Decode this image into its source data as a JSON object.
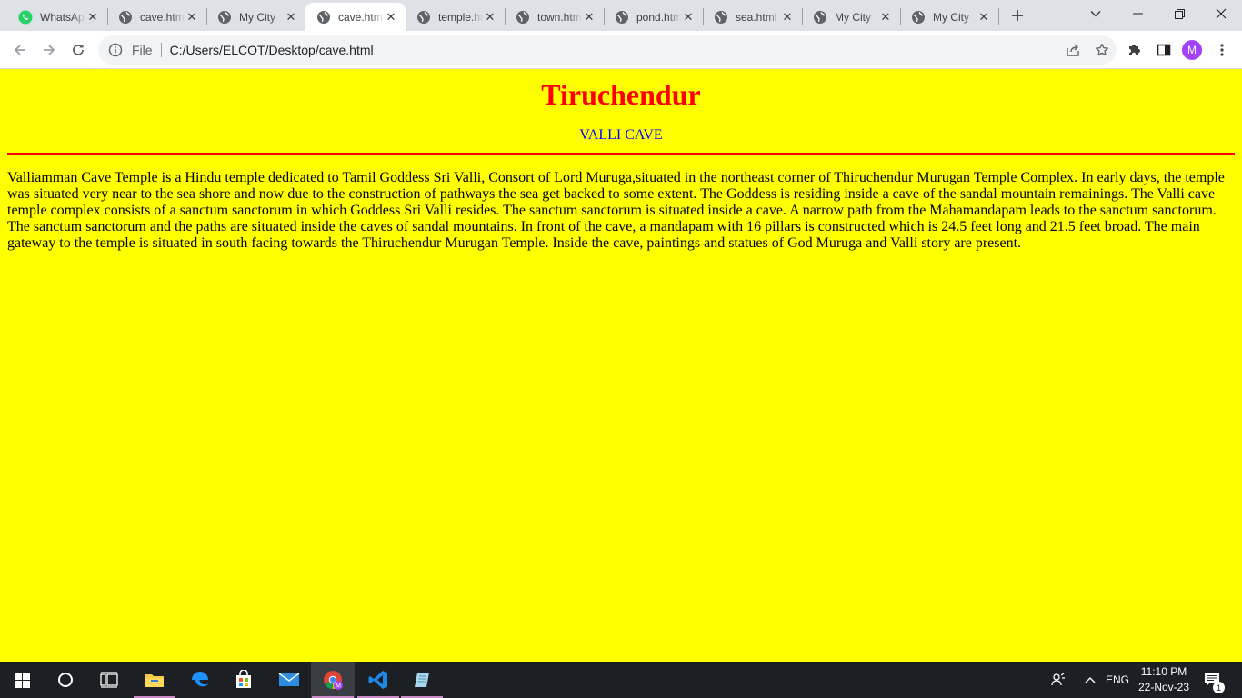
{
  "browser": {
    "tabs": [
      {
        "title": "WhatsApp",
        "icon": "whatsapp-icon",
        "active": false
      },
      {
        "title": "cave.html",
        "icon": "globe-icon",
        "active": false
      },
      {
        "title": "My City",
        "icon": "globe-icon",
        "active": false
      },
      {
        "title": "cave.html",
        "icon": "globe-icon",
        "active": true
      },
      {
        "title": "temple.html",
        "icon": "globe-icon",
        "active": false
      },
      {
        "title": "town.html",
        "icon": "globe-icon",
        "active": false
      },
      {
        "title": "pond.html",
        "icon": "globe-icon",
        "active": false
      },
      {
        "title": "sea.html",
        "icon": "globe-icon",
        "active": false
      },
      {
        "title": "My City",
        "icon": "globe-icon",
        "active": false
      },
      {
        "title": "My City",
        "icon": "globe-icon",
        "active": false
      }
    ],
    "address": {
      "scheme_label": "File",
      "url": "C:/Users/ELCOT/Desktop/cave.html"
    },
    "profile_initial": "M"
  },
  "page": {
    "title": "Tiruchendur",
    "subtitle": "VALLI CAVE",
    "paragraph": "Valliamman Cave Temple is a Hindu temple dedicated to Tamil Goddess Sri Valli, Consort of Lord Muruga,situated in the northeast corner of Thiruchendur Murugan Temple Complex. In early days, the temple was situated very near to the sea shore and now due to the construction of pathways the sea get backed to some extent. The Goddess is residing inside a cave of the sandal mountain remainings. The Valli cave temple complex consists of a sanctum sanctorum in which Goddess Sri Valli resides. The sanctum sanctorum is situated inside a cave. A narrow path from the Mahamandapam leads to the sanctum sanctorum. The sanctum sanctorum and the paths are situated inside the caves of sandal mountains. In front of the cave, a mandapam with 16 pillars is constructed which is 24.5 feet long and 21.5 feet broad. The main gateway to the temple is situated in south facing towards the Thiruchendur Murugan Temple. Inside the cave, paintings and statues of God Muruga and Valli story are present.",
    "colors": {
      "background": "#ffff00",
      "title": "#ff0000",
      "subtitle": "#0000ff",
      "rule": "#ff0000"
    }
  },
  "taskbar": {
    "language": "ENG",
    "time": "11:10 PM",
    "date": "22-Nov-23",
    "notification_count": "1"
  }
}
